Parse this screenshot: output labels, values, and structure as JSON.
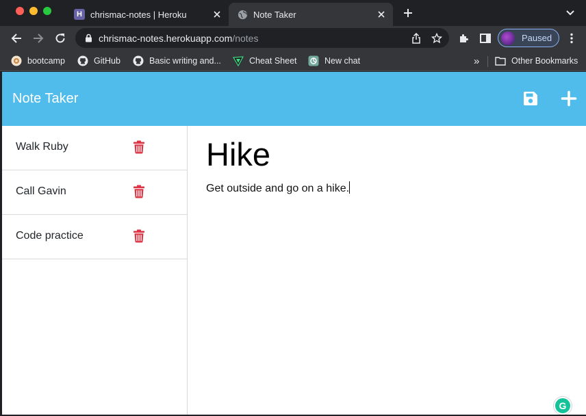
{
  "browser": {
    "tabs": [
      {
        "title": "chrismac-notes | Heroku",
        "favicon": "heroku-icon",
        "active": false
      },
      {
        "title": "Note Taker",
        "favicon": "globe-icon",
        "active": true
      }
    ],
    "url": {
      "domain": "chrismac-notes.herokuapp.com",
      "path": "/notes"
    },
    "profile_status": "Paused",
    "bookmarks": [
      {
        "label": "bootcamp",
        "icon": "bootcamp-icon"
      },
      {
        "label": "GitHub",
        "icon": "github-icon"
      },
      {
        "label": "Basic writing and...",
        "icon": "github-icon"
      },
      {
        "label": "Cheat Sheet",
        "icon": "cheatsheet-icon"
      },
      {
        "label": "New chat",
        "icon": "chat-icon"
      }
    ],
    "other_bookmarks": "Other Bookmarks",
    "overflow": "»"
  },
  "app": {
    "brand": "Note Taker",
    "colors": {
      "navbar": "#50bcec",
      "trash": "#dc3545"
    },
    "notes": [
      {
        "title": "Walk Ruby"
      },
      {
        "title": "Call Gavin"
      },
      {
        "title": "Code practice"
      }
    ],
    "active_note": {
      "title": "Hike",
      "text": "Get outside and go on a hike."
    }
  }
}
